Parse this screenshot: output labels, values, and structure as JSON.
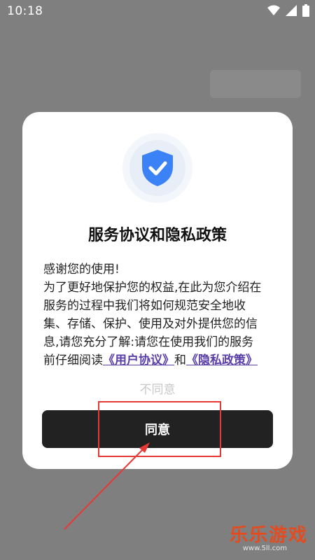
{
  "status_bar": {
    "time": "10:18"
  },
  "dialog": {
    "title": "服务协议和隐私政策",
    "body_lines": [
      "感谢您的使用!",
      "为了更好地保护您的权益,在此为您介绍在",
      "服务的过程中我们将如何规范安全地收",
      "集、存储、保护、使用及对外提供您的信",
      "息,请您充分了解:请您在使用我们的服务"
    ],
    "last_line_prefix": "前仔细阅读",
    "user_agreement_link": "《用户协议》",
    "conjunction": "和",
    "privacy_policy_link": "《隐私政策》",
    "disagree_label": "不同意",
    "agree_label": "同意"
  },
  "watermark": {
    "text": "乐乐游戏",
    "url": "www.5ll.com"
  },
  "colors": {
    "overlay": "#7f7f7f",
    "shield": "#3b82f6",
    "link": "#5b3fa8",
    "agree_button": "#222222",
    "annotation": "#e53935",
    "watermark": "#e54b1e"
  }
}
